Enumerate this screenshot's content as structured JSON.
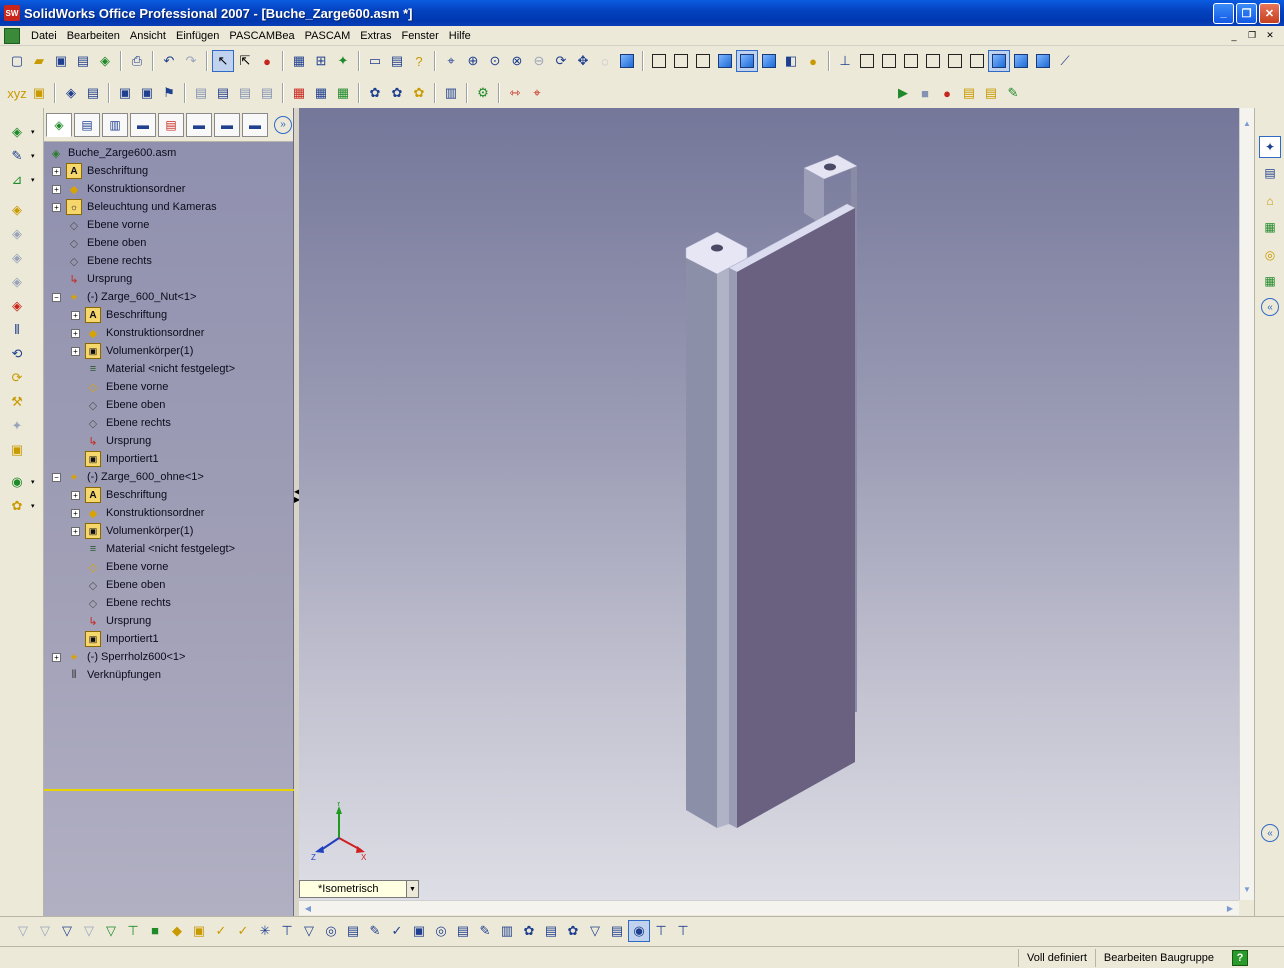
{
  "window": {
    "app_badge": "SW",
    "title": "SolidWorks Office Professional 2007 - [Buche_Zarge600.asm *]",
    "minimize": "_",
    "maximize": "❐",
    "close": "✕"
  },
  "menubar": {
    "items": [
      "Datei",
      "Bearbeiten",
      "Ansicht",
      "Einfügen",
      "PASCAMBea",
      "PASCAM",
      "Extras",
      "Fenster",
      "Hilfe"
    ],
    "mdi_minimize": "_",
    "mdi_restore": "❐",
    "mdi_close": "✕"
  },
  "feature_tree": {
    "root": "Buche_Zarge600.asm",
    "rows": [
      {
        "label": "Beschriftung",
        "icon": "A"
      },
      {
        "label": "Konstruktionsordner",
        "icon": "◆"
      },
      {
        "label": "Beleuchtung und Kameras",
        "icon": "☼"
      },
      {
        "label": "Ebene vorne",
        "icon": "◇"
      },
      {
        "label": "Ebene oben",
        "icon": "◇"
      },
      {
        "label": "Ebene rechts",
        "icon": "◇"
      },
      {
        "label": "Ursprung",
        "icon": "↳"
      },
      {
        "label": "(-) Zarge_600_Nut<1>",
        "icon": "✦"
      },
      {
        "label": "Beschriftung",
        "icon": "A"
      },
      {
        "label": "Konstruktionsordner",
        "icon": "◆"
      },
      {
        "label": "Volumenkörper(1)",
        "icon": "▣"
      },
      {
        "label": "Material <nicht festgelegt>",
        "icon": "≡"
      },
      {
        "label": "Ebene vorne",
        "icon": "◇"
      },
      {
        "label": "Ebene oben",
        "icon": "◇"
      },
      {
        "label": "Ebene rechts",
        "icon": "◇"
      },
      {
        "label": "Ursprung",
        "icon": "↳"
      },
      {
        "label": "Importiert1",
        "icon": "▣"
      },
      {
        "label": "(-) Zarge_600_ohne<1>",
        "icon": "✦"
      },
      {
        "label": "Beschriftung",
        "icon": "A"
      },
      {
        "label": "Konstruktionsordner",
        "icon": "◆"
      },
      {
        "label": "Volumenkörper(1)",
        "icon": "▣"
      },
      {
        "label": "Material <nicht festgelegt>",
        "icon": "≡"
      },
      {
        "label": "Ebene vorne",
        "icon": "◇"
      },
      {
        "label": "Ebene oben",
        "icon": "◇"
      },
      {
        "label": "Ebene rechts",
        "icon": "◇"
      },
      {
        "label": "Ursprung",
        "icon": "↳"
      },
      {
        "label": "Importiert1",
        "icon": "▣"
      },
      {
        "label": "(-) Sperrholz600<1>",
        "icon": "✦"
      },
      {
        "label": "Verknüpfungen",
        "icon": "⦀"
      }
    ]
  },
  "viewport": {
    "view_orientation": "*Isometrisch",
    "triad": {
      "x": "X",
      "y": "Y",
      "z": "Z"
    }
  },
  "statusbar": {
    "state": "Voll definiert",
    "mode": "Bearbeiten Baugruppe",
    "help": "?"
  },
  "colors": {
    "viewport_top": "#75779a",
    "viewport_bottom": "#dedee6",
    "tree_bg": "#9a9ab3",
    "model_face": "#6a6080",
    "model_side": "#8c8fa8",
    "model_top": "#dcdcf0"
  }
}
